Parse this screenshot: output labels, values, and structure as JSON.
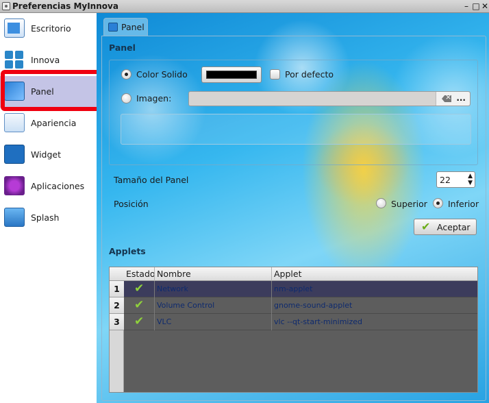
{
  "window": {
    "title": "Preferencias MyInnova"
  },
  "sidebar": {
    "items": [
      {
        "label": "Escritorio",
        "icon": "desktop-icon"
      },
      {
        "label": "Innova",
        "icon": "innova-icon"
      },
      {
        "label": "Panel",
        "icon": "panel-icon",
        "selected": true
      },
      {
        "label": "Apariencia",
        "icon": "appearance-icon"
      },
      {
        "label": "Widget",
        "icon": "widget-icon"
      },
      {
        "label": "Aplicaciones",
        "icon": "applications-icon"
      },
      {
        "label": "Splash",
        "icon": "splash-icon"
      }
    ]
  },
  "tab": {
    "label": "Panel"
  },
  "panel": {
    "section_title": "Panel",
    "color_solid_label": "Color Solido",
    "color_value": "#000000",
    "default_label": "Por defecto",
    "image_label": "Imagen:",
    "image_value": "",
    "browse_label": "...",
    "size_label": "Tamaño del Panel",
    "size_value": "22",
    "position_label": "Posición",
    "position_top": "Superior",
    "position_bottom": "Inferior",
    "position_selected": "Inferior",
    "accept_label": "Aceptar"
  },
  "applets": {
    "section_title": "Applets",
    "columns": [
      "Estado",
      "Nombre",
      "Applet"
    ],
    "rows": [
      {
        "num": "1",
        "estado": true,
        "nombre": "Network",
        "applet": "nm-applet"
      },
      {
        "num": "2",
        "estado": true,
        "nombre": "Volume Control",
        "applet": "gnome-sound-applet"
      },
      {
        "num": "3",
        "estado": true,
        "nombre": "VLC",
        "applet": "vlc --qt-start-minimized"
      }
    ]
  },
  "colors": {
    "selection_outline": "#f00010",
    "sidebar_selected": "#c4c4e6",
    "table_bg": "#5d5d5d"
  }
}
